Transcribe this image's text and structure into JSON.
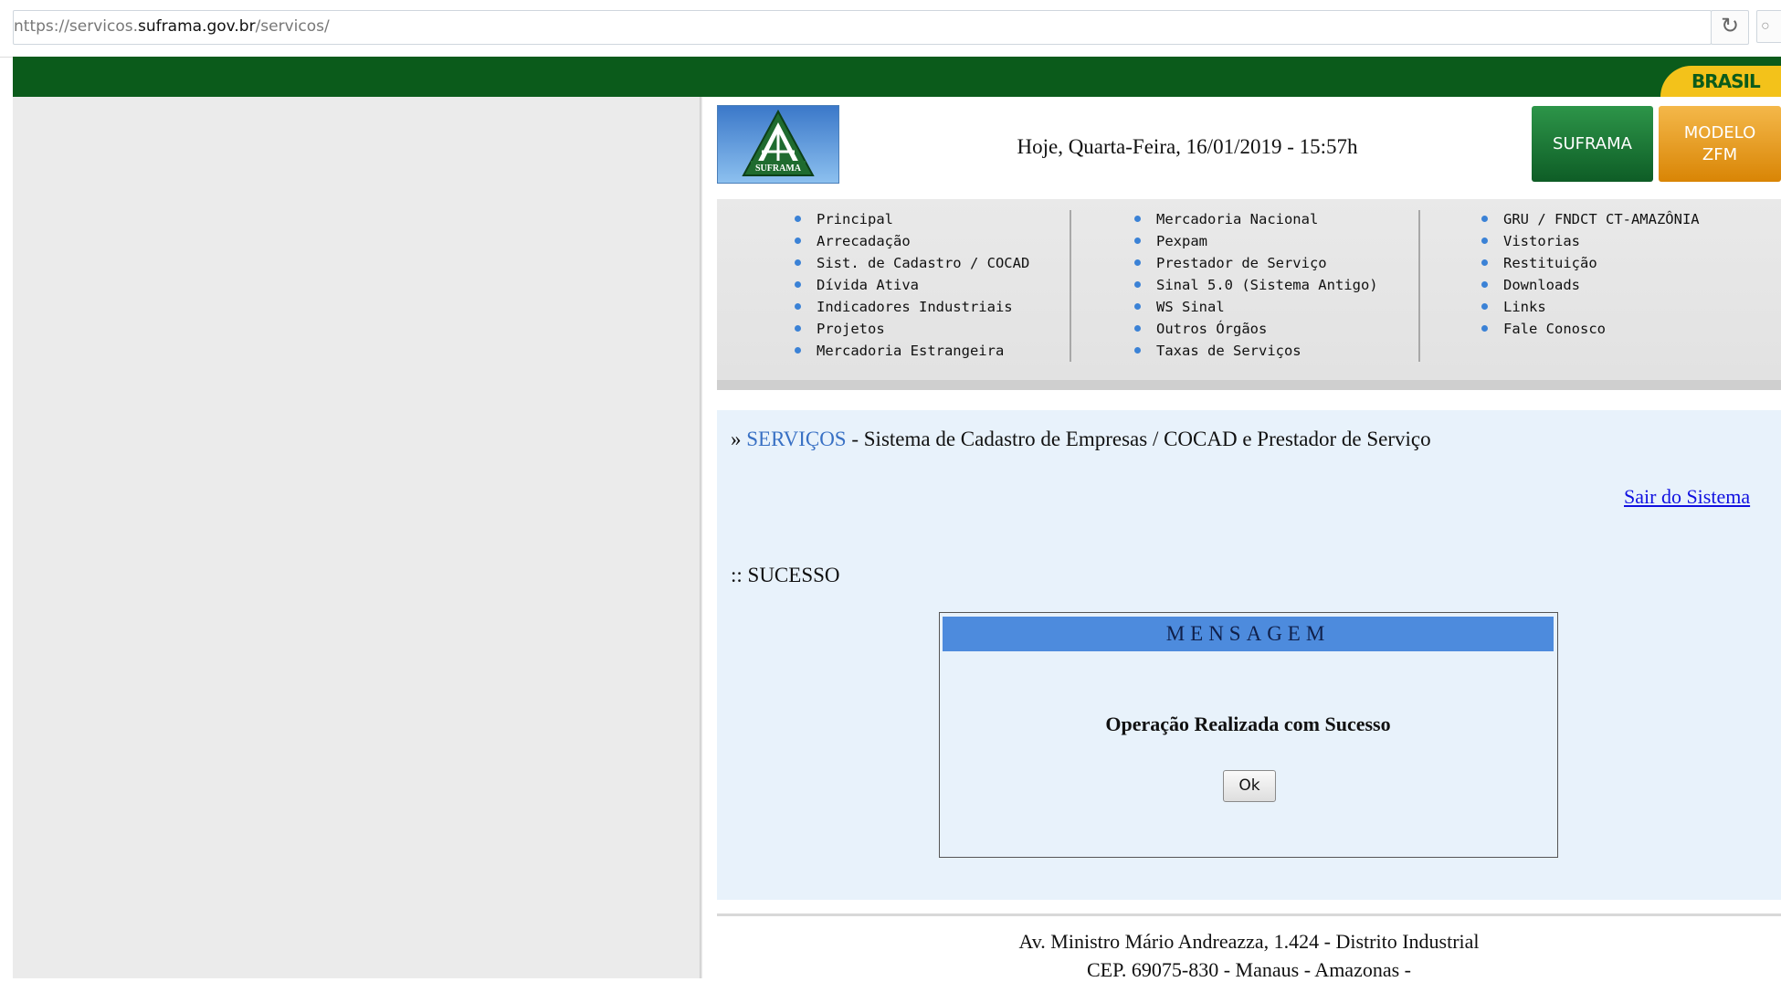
{
  "browser": {
    "url_prefix": "nttps://servicos.",
    "url_domain": "suframa.gov.br",
    "url_path": "/servicos/",
    "reload_icon": "reload-icon"
  },
  "gov_bar": {
    "brasil_label": "BRASIL"
  },
  "header": {
    "datetime": "Hoje, Quarta-Feira, 16/01/2019 - 15:57h",
    "logo_text": "SUFRAMA",
    "btn_suframa": "SUFRAMA",
    "btn_modelo_line1": "MODELO",
    "btn_modelo_line2": "ZFM"
  },
  "menu": {
    "col1": [
      "Principal",
      "Arrecadação",
      "Sist. de Cadastro / COCAD",
      "Dívida Ativa",
      "Indicadores Industriais",
      "Projetos",
      "Mercadoria Estrangeira"
    ],
    "col2": [
      "Mercadoria Nacional",
      "Pexpam",
      "Prestador de Serviço",
      "Sinal 5.0 (Sistema Antigo)",
      "WS Sinal",
      "Outros Órgãos",
      "Taxas de Serviços"
    ],
    "col3": [
      "GRU / FNDCT CT-AMAZÔNIA",
      "Vistorias",
      "Restituição",
      "Downloads",
      "Links",
      "Fale Conosco"
    ]
  },
  "service": {
    "breadcrumb_prefix": "» ",
    "breadcrumb_link": "SERVIÇOS",
    "breadcrumb_rest": " - Sistema de Cadastro de Empresas / COCAD e Prestador de Serviço",
    "logout": "Sair do Sistema",
    "status": ":: SUCESSO"
  },
  "dialog": {
    "title": "MENSAGEM",
    "message": "Operação Realizada com Sucesso",
    "ok": "Ok"
  },
  "footer": {
    "line1": "Av. Ministro Mário Andreazza, 1.424 - Distrito Industrial",
    "line2": "CEP. 69075-830 - Manaus - Amazonas -"
  },
  "colors": {
    "gov_green": "#0b5b1b",
    "brasil_yellow": "#f3c21a",
    "link_blue": "#3870c4",
    "dialog_header": "#4d8bdd",
    "service_bg": "#e8f2fb"
  }
}
